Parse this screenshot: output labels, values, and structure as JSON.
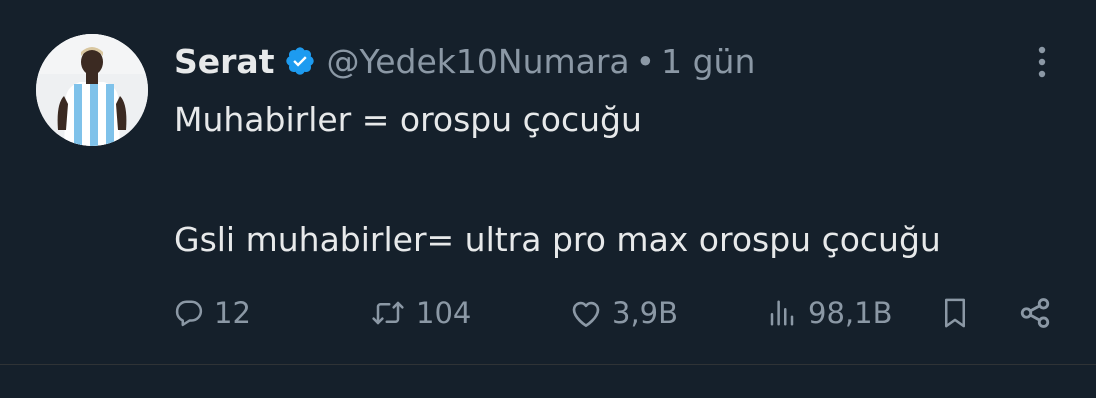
{
  "tweet": {
    "author": {
      "name": "Serat",
      "handle": "@Yedek10Numara",
      "separator": "•",
      "time": "1 gün",
      "avatar_icon": "avatar-photo"
    },
    "text": {
      "line1": "Muhabirler = orospu çocuğu",
      "line2": "Gsli muhabirler= ultra pro max orospu çocuğu"
    },
    "actions": {
      "replies": "12",
      "retweets": "104",
      "likes": "3,9B",
      "views": "98,1B"
    },
    "icons": {
      "verified": "verified-badge-icon",
      "more": "more-options-icon",
      "reply": "reply-icon",
      "retweet": "retweet-icon",
      "like": "heart-icon",
      "views": "views-icon",
      "bookmark": "bookmark-icon",
      "share": "share-icon"
    },
    "colors": {
      "background": "#15202b",
      "text": "#e7e9ea",
      "secondary": "#8b98a5",
      "verified": "#1d9bf0"
    }
  }
}
